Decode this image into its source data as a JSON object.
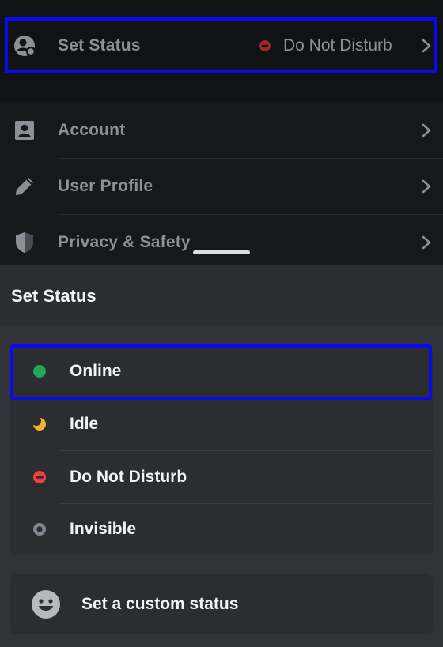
{
  "settings": {
    "set_status": {
      "label": "Set Status",
      "value": "Do Not Disturb"
    },
    "items": [
      {
        "label": "Account",
        "icon": "account-card-icon"
      },
      {
        "label": "User Profile",
        "icon": "pencil-icon"
      },
      {
        "label": "Privacy & Safety",
        "icon": "shield-icon"
      }
    ]
  },
  "sheet": {
    "title": "Set Status",
    "options": [
      {
        "label": "Online",
        "icon": "online-dot-icon",
        "color": "#23a55a"
      },
      {
        "label": "Idle",
        "icon": "moon-icon",
        "color": "#f0b232"
      },
      {
        "label": "Do Not Disturb",
        "icon": "dnd-icon",
        "color": "#f23f43"
      },
      {
        "label": "Invisible",
        "icon": "invisible-ring-icon",
        "color": "#80848e"
      }
    ],
    "custom_status": {
      "label": "Set a custom status",
      "icon": "smiley-face-icon"
    }
  },
  "colors": {
    "highlight": "#0a0af0",
    "text": "#f2f3f5",
    "muted": "#8c8f95"
  }
}
